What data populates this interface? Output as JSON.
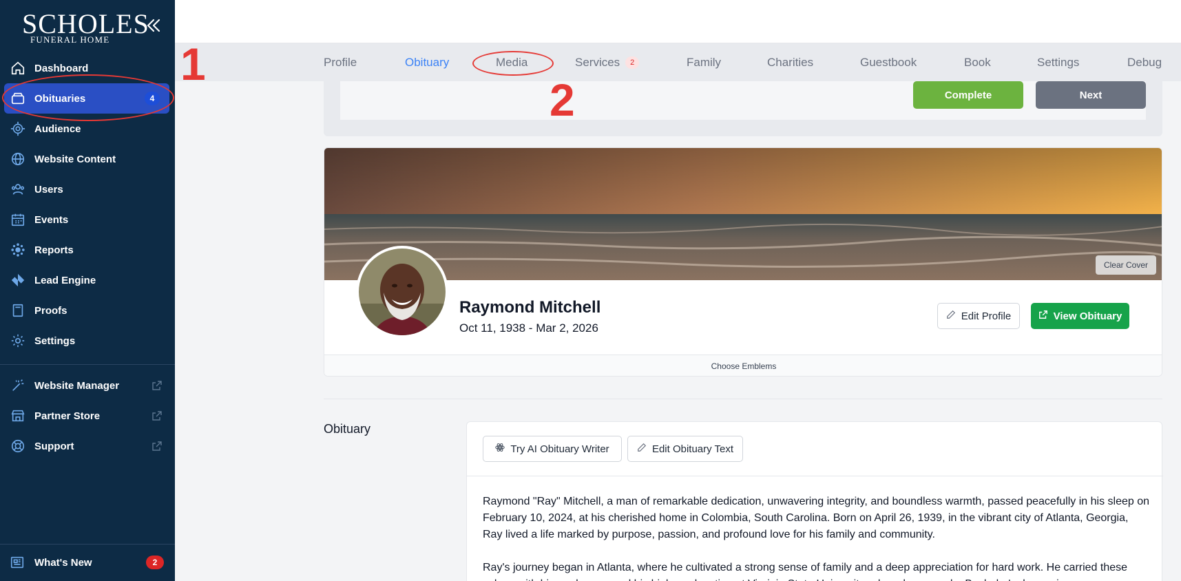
{
  "brand": {
    "name": "SCHOLES",
    "subtitle": "FUNERAL HOME"
  },
  "sidebar": {
    "items": [
      {
        "label": "Dashboard",
        "icon": "home-icon"
      },
      {
        "label": "Obituaries",
        "icon": "archive-icon",
        "badge": "4",
        "active": true
      },
      {
        "label": "Audience",
        "icon": "target-icon"
      },
      {
        "label": "Website Content",
        "icon": "globe-icon"
      },
      {
        "label": "Users",
        "icon": "users-icon"
      },
      {
        "label": "Events",
        "icon": "calendar-icon"
      },
      {
        "label": "Reports",
        "icon": "reports-icon"
      },
      {
        "label": "Lead Engine",
        "icon": "aperture-icon"
      },
      {
        "label": "Proofs",
        "icon": "book-icon"
      },
      {
        "label": "Settings",
        "icon": "gear-icon"
      }
    ],
    "external": [
      {
        "label": "Website Manager",
        "icon": "magic-wand-icon"
      },
      {
        "label": "Partner Store",
        "icon": "store-icon"
      },
      {
        "label": "Support",
        "icon": "lifebuoy-icon"
      }
    ],
    "whats_new": {
      "label": "What's New",
      "badge": "2"
    }
  },
  "tabs": [
    {
      "label": "Profile"
    },
    {
      "label": "Obituary",
      "active": true
    },
    {
      "label": "Media"
    },
    {
      "label": "Services",
      "badge": "2"
    },
    {
      "label": "Family"
    },
    {
      "label": "Charities"
    },
    {
      "label": "Guestbook"
    },
    {
      "label": "Book"
    },
    {
      "label": "Settings"
    },
    {
      "label": "Debug"
    }
  ],
  "annotations": {
    "one": "1",
    "two": "2"
  },
  "actions": {
    "complete": "Complete",
    "next": "Next"
  },
  "profile": {
    "clear_cover": "Clear Cover",
    "name": "Raymond Mitchell",
    "dates": "Oct 11, 1938 - Mar 2, 2026",
    "edit_profile": "Edit Profile",
    "view_obituary": "View Obituary",
    "choose_emblems": "Choose Emblems"
  },
  "obituary": {
    "section_label": "Obituary",
    "ai_writer": "Try AI Obituary Writer",
    "edit_text": "Edit Obituary Text",
    "paragraphs": [
      "Raymond \"Ray\" Mitchell, a man of remarkable dedication, unwavering integrity, and boundless warmth, passed peacefully in his sleep on February 10, 2024, at his cherished home in Colombia, South Carolina. Born on April 26, 1939, in the vibrant city of Atlanta, Georgia, Ray lived a life marked by purpose, passion, and profound love for his family and community.",
      "Ray's journey began in Atlanta, where he cultivated a strong sense of family and a deep appreciation for hard work. He carried these values with him as he pursued his higher education at Virginia State University, where he earned a Bachelor's degree in"
    ]
  },
  "colors": {
    "sidebar": "#0d2b45",
    "active": "#2a4fc4",
    "accent": "#3b82f6",
    "complete": "#6cb33f",
    "view": "#16a34a",
    "annotation": "#e53935"
  }
}
